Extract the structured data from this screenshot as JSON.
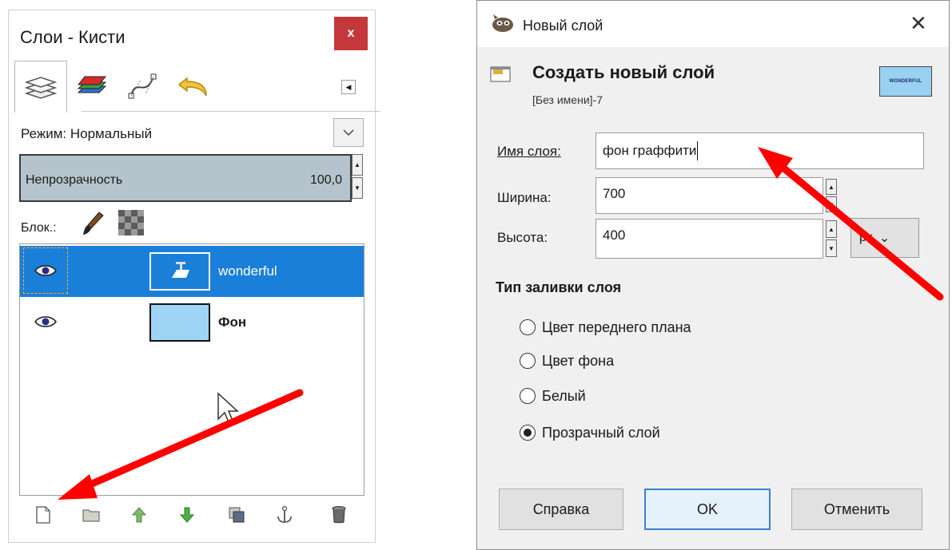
{
  "layers_panel": {
    "title": "Слои - Кисти",
    "close_label": "x",
    "tabs": [
      {
        "name": "layers",
        "icon": "layers-icon"
      },
      {
        "name": "channels",
        "icon": "channels-icon"
      },
      {
        "name": "paths",
        "icon": "paths-icon"
      },
      {
        "name": "undo-history",
        "icon": "undo-history-icon"
      }
    ],
    "mode_label": "Режим: Нормальный",
    "opacity_label": "Непрозрачность",
    "opacity_value": "100,0",
    "lock_label": "Блок.:",
    "layers": [
      {
        "name": "wonderful",
        "selected": true,
        "visible": true,
        "bold": false
      },
      {
        "name": "Фон",
        "selected": false,
        "visible": true,
        "bold": true
      }
    ],
    "bottom_buttons": [
      "new-layer-icon",
      "new-layer-group-icon",
      "raise-layer-icon",
      "lower-layer-icon",
      "duplicate-layer-icon",
      "anchor-layer-icon",
      "delete-layer-icon"
    ]
  },
  "dialog": {
    "title": "Новый слой",
    "heading": "Создать новый слой",
    "subtitle": "[Без имени]-7",
    "preview_text": "WONDERFUL",
    "name_label": "Имя слоя:",
    "name_value": "фон граффити",
    "width_label": "Ширина:",
    "width_value": "700",
    "height_label": "Высота:",
    "height_value": "400",
    "unit_value": "px",
    "fill_type_title": "Тип заливки слоя",
    "fill_options": [
      {
        "label": "Цвет переднего плана",
        "checked": false
      },
      {
        "label": "Цвет фона",
        "checked": false
      },
      {
        "label": "Белый",
        "checked": false
      },
      {
        "label": "Прозрачный слой",
        "checked": true
      }
    ],
    "buttons": {
      "help": "Справка",
      "ok": "OK",
      "cancel": "Отменить"
    }
  },
  "colors": {
    "selection": "#1a7fd8",
    "arrow": "#ff0000",
    "close_red": "#c4383c",
    "opacity_bg": "#b5c4cc"
  }
}
